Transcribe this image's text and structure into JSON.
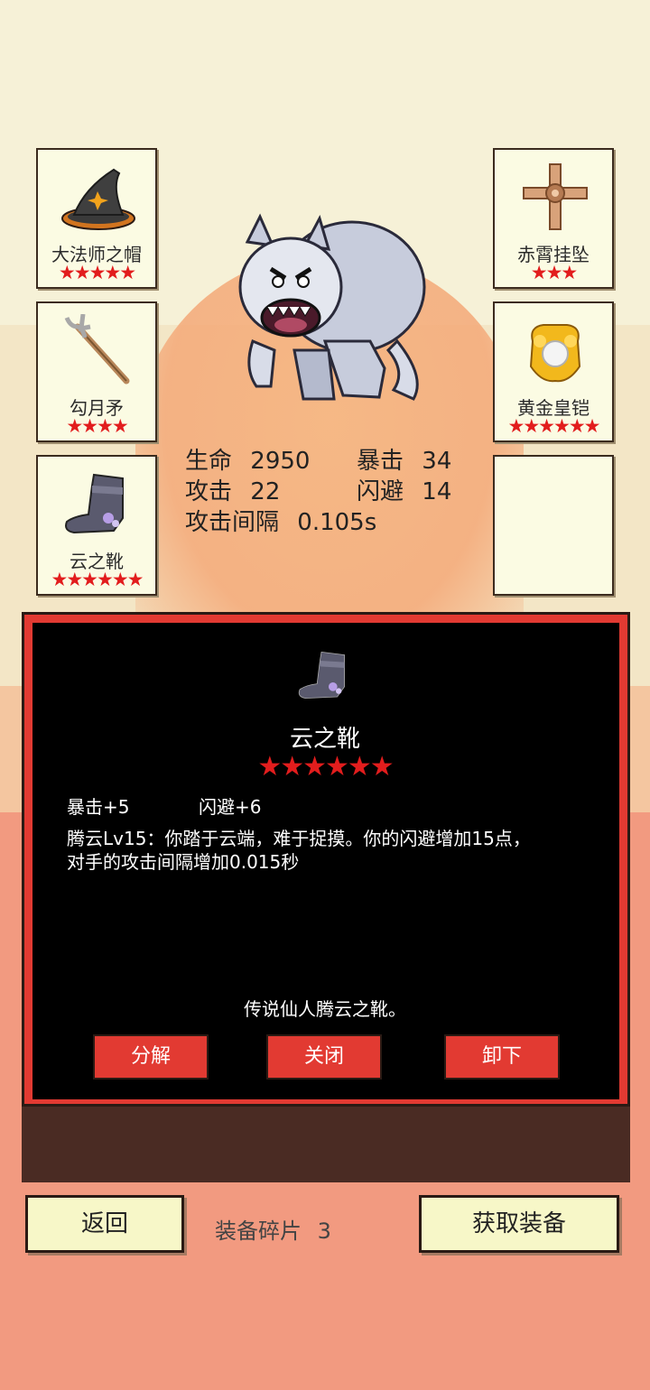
{
  "slots": {
    "left1": {
      "name": "大法师之帽",
      "stars": "★★★★★",
      "icon": "wizard-hat-icon"
    },
    "left2": {
      "name": "勾月矛",
      "stars": "★★★★",
      "icon": "spear-icon"
    },
    "left3": {
      "name": "云之靴",
      "stars": "★★★★★★",
      "icon": "boot-icon"
    },
    "right1": {
      "name": "赤霄挂坠",
      "stars": "★★★",
      "icon": "cross-pendant-icon"
    },
    "right2": {
      "name": "黄金皇铠",
      "stars": "★★★★★★",
      "icon": "golden-armor-icon"
    },
    "right3": {
      "name": "",
      "stars": ""
    }
  },
  "stats": {
    "hp_label": "生命",
    "hp_value": "2950",
    "crit_label": "暴击",
    "crit_value": "34",
    "atk_label": "攻击",
    "atk_value": "22",
    "dodge_label": "闪避",
    "dodge_value": "14",
    "interval_label": "攻击间隔",
    "interval_value": "0.105s"
  },
  "detail": {
    "name": "云之靴",
    "stars": "★★★★★★",
    "attr1": "暴击+5",
    "attr2": "闪避+6",
    "desc_line1": "腾云Lv15：你踏于云端，难于捉摸。你的闪避增加15点，",
    "desc_line2": "对手的攻击间隔增加0.015秒",
    "lore": "传说仙人腾云之靴。",
    "btn_decompose": "分解",
    "btn_close": "关闭",
    "btn_unequip": "卸下"
  },
  "bottom": {
    "back": "返回",
    "fragments_label": "装备碎片",
    "fragments_count": "3",
    "get_equipment": "获取装备"
  },
  "colors": {
    "accent_red": "#e23a32",
    "star_red": "#e21d1d",
    "panel_bg": "#000000",
    "button_cream": "#f7f7c8"
  }
}
